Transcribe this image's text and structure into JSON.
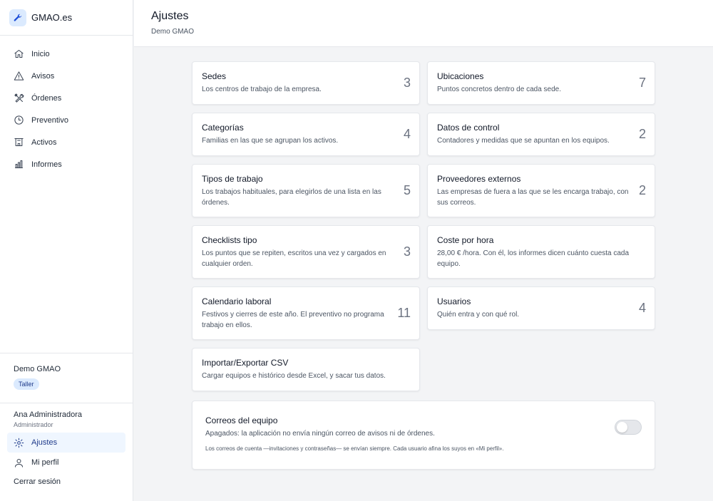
{
  "app": {
    "name": "GMAO.es",
    "accent": "#1e40af"
  },
  "sidebar": {
    "items": [
      {
        "label": "Inicio",
        "icon": "home-icon"
      },
      {
        "label": "Avisos",
        "icon": "warning-icon"
      },
      {
        "label": "Órdenes",
        "icon": "tools-icon"
      },
      {
        "label": "Preventivo",
        "icon": "clock-icon"
      },
      {
        "label": "Activos",
        "icon": "building-icon"
      },
      {
        "label": "Informes",
        "icon": "bar-chart-icon"
      }
    ],
    "org_name": "Demo GMAO",
    "org_badge": "Taller",
    "user_name": "Ana Administradora",
    "user_role": "Administrador",
    "settings_label": "Ajustes",
    "profile_label": "Mi perfil",
    "logout_label": "Cerrar sesión"
  },
  "header": {
    "title": "Ajustes",
    "subtitle": "Demo GMAO"
  },
  "cards": [
    {
      "title": "Sedes",
      "desc": "Los centros de trabajo de la empresa.",
      "count": "3"
    },
    {
      "title": "Ubicaciones",
      "desc": "Puntos concretos dentro de cada sede.",
      "count": "7"
    },
    {
      "title": "Categorías",
      "desc": "Familias en las que se agrupan los activos.",
      "count": "4"
    },
    {
      "title": "Datos de control",
      "desc": "Contadores y medidas que se apuntan en los equipos.",
      "count": "2"
    },
    {
      "title": "Tipos de trabajo",
      "desc": "Los trabajos habituales, para elegirlos de una lista en las órdenes.",
      "count": "5"
    },
    {
      "title": "Proveedores externos",
      "desc": "Las empresas de fuera a las que se les encarga trabajo, con sus correos.",
      "count": "2"
    },
    {
      "title": "Checklists tipo",
      "desc": "Los puntos que se repiten, escritos una vez y cargados en cualquier orden.",
      "count": "3"
    },
    {
      "title": "Coste por hora",
      "desc": "28,00 € /hora. Con él, los informes dicen cuánto cuesta cada equipo.",
      "count": ""
    },
    {
      "title": "Calendario laboral",
      "desc": "Festivos y cierres de este año. El preventivo no programa trabajo en ellos.",
      "count": "11"
    },
    {
      "title": "Usuarios",
      "desc": "Quién entra y con qué rol.",
      "count": "4"
    },
    {
      "title": "Importar/Exportar CSV",
      "desc": "Cargar equipos e histórico desde Excel, y sacar tus datos.",
      "count": ""
    }
  ],
  "mail": {
    "title": "Correos del equipo",
    "desc": "Apagados: la aplicación no envía ningún correo de avisos ni de órdenes.",
    "note": "Los correos de cuenta —invitaciones y contraseñas— se envían siempre. Cada usuario afina los suyos en «Mi perfil».",
    "enabled": false
  }
}
